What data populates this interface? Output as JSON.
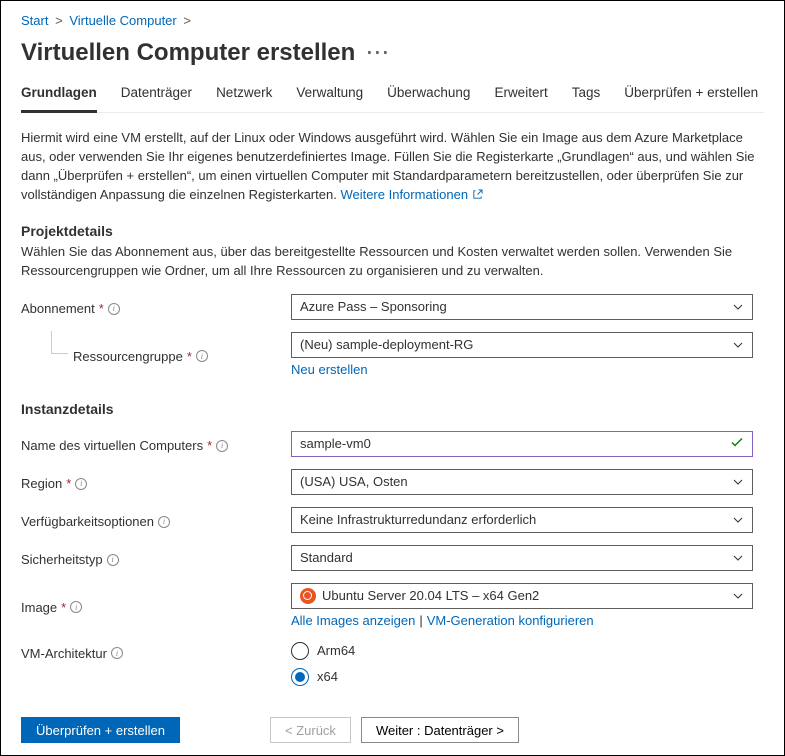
{
  "breadcrumb": {
    "item1": "Start",
    "item2": "Virtuelle Computer"
  },
  "page": {
    "title": "Virtuellen Computer erstellen"
  },
  "tabs": {
    "t0": "Grundlagen",
    "t1": "Datenträger",
    "t2": "Netzwerk",
    "t3": "Verwaltung",
    "t4": "Überwachung",
    "t5": "Erweitert",
    "t6": "Tags",
    "t7": "Überprüfen + erstellen"
  },
  "intro": {
    "text": "Hiermit wird eine VM erstellt, auf der Linux oder Windows ausgeführt wird. Wählen Sie ein Image aus dem Azure Marketplace aus, oder verwenden Sie Ihr eigenes benutzerdefiniertes Image. Füllen Sie die Registerkarte „Grundlagen“ aus, und wählen Sie dann „Überprüfen + erstellen“, um einen virtuellen Computer mit Standardparametern bereitzustellen, oder überprüfen Sie zur vollständigen Anpassung die einzelnen Registerkarten. ",
    "link": "Weitere Informationen"
  },
  "project": {
    "heading": "Projektdetails",
    "desc": "Wählen Sie das Abonnement aus, über das bereitgestellte Ressourcen und Kosten verwaltet werden sollen. Verwenden Sie Ressourcengruppen wie Ordner, um all Ihre Ressourcen zu organisieren und zu verwalten.",
    "sub_label": "Abonnement",
    "sub_value": "Azure Pass – Sponsoring",
    "rg_label": "Ressourcengruppe",
    "rg_value": "(Neu) sample-deployment-RG",
    "rg_new": "Neu erstellen"
  },
  "instance": {
    "heading": "Instanzdetails",
    "name_label": "Name des virtuellen Computers",
    "name_value": "sample-vm0",
    "region_label": "Region",
    "region_value": "(USA) USA, Osten",
    "avail_label": "Verfügbarkeitsoptionen",
    "avail_value": "Keine Infrastrukturredundanz erforderlich",
    "sec_label": "Sicherheitstyp",
    "sec_value": "Standard",
    "image_label": "Image",
    "image_value": "Ubuntu Server 20.04 LTS – x64 Gen2",
    "image_link1": "Alle Images anzeigen",
    "image_link2": "VM-Generation konfigurieren",
    "arch_label": "VM-Architektur",
    "arch_opt1": "Arm64",
    "arch_opt2": "x64"
  },
  "footer": {
    "review": "Überprüfen + erstellen",
    "back": "< Zurück",
    "next": "Weiter : Datenträger >"
  }
}
